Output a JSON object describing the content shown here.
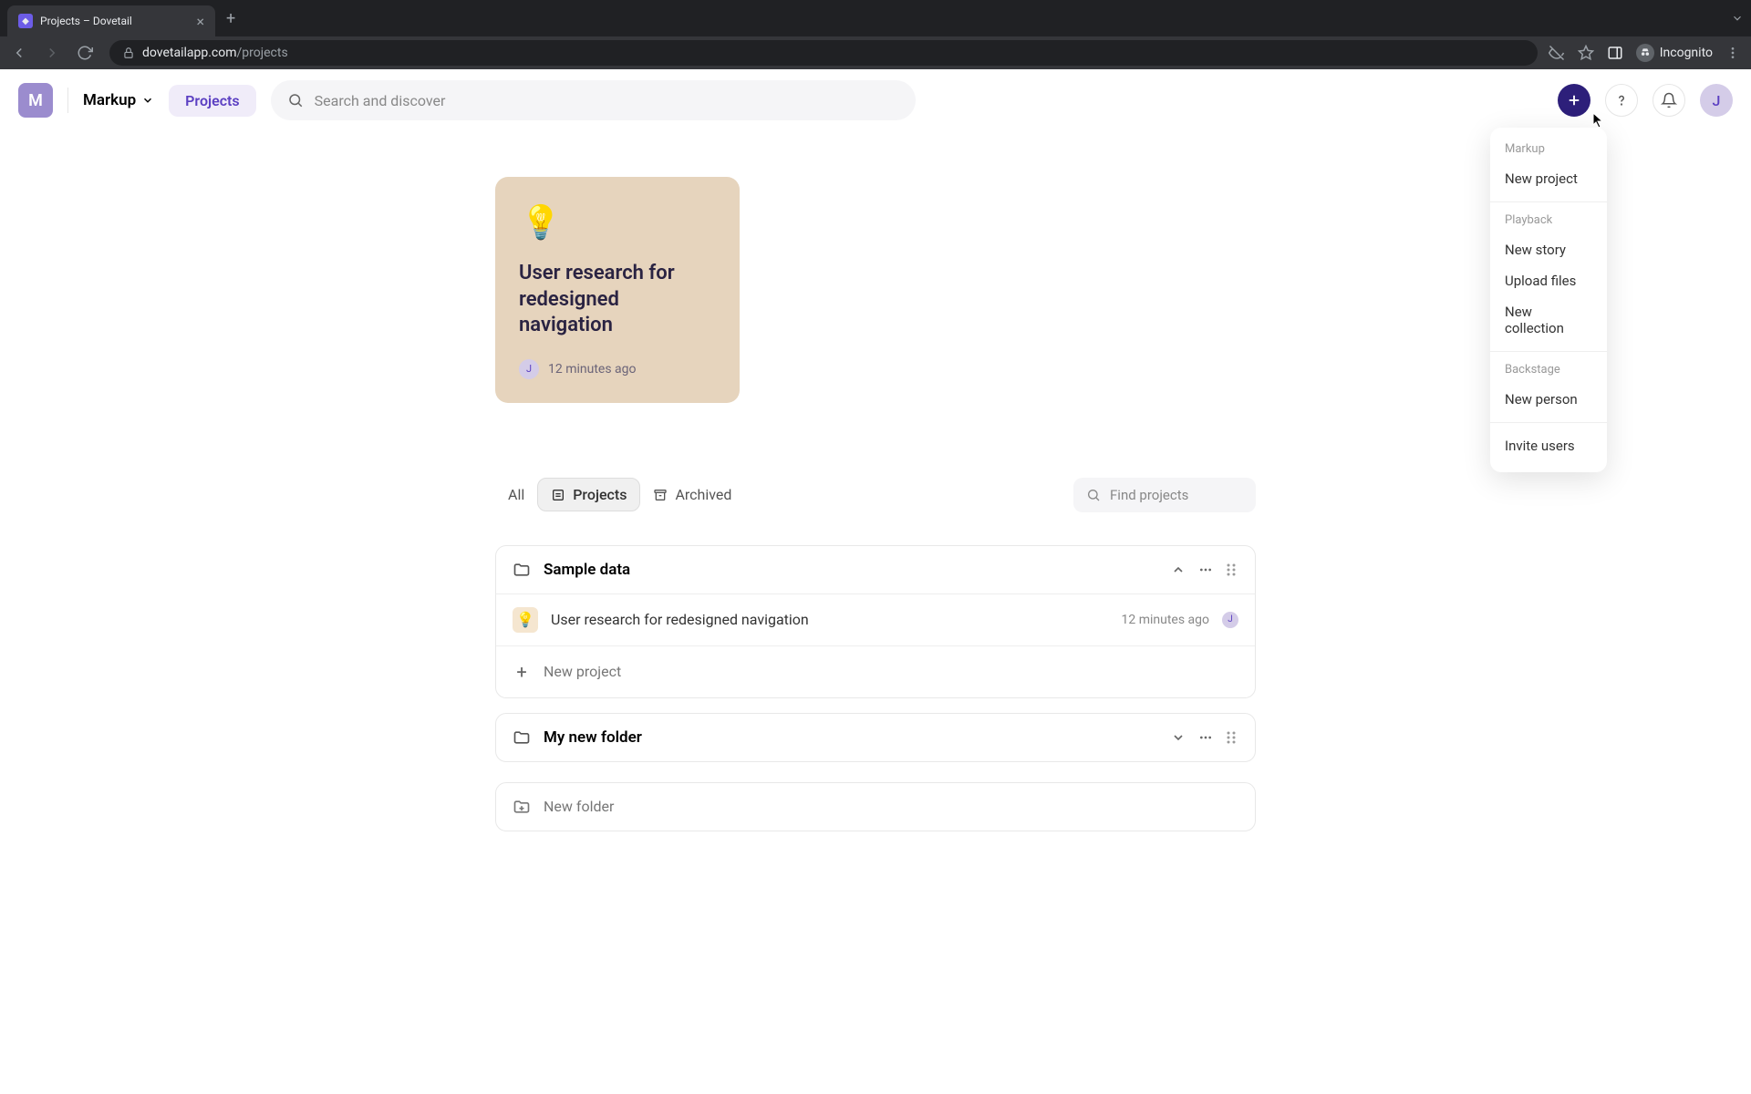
{
  "browser": {
    "tab_title": "Projects – Dovetail",
    "url_domain": "dovetailapp.com",
    "url_path": "/projects",
    "incognito_label": "Incognito"
  },
  "header": {
    "workspace_initial": "M",
    "workspace_name": "Markup",
    "nav_label": "Projects",
    "search_placeholder": "Search and discover",
    "user_initial": "J"
  },
  "dropdown": {
    "sections": [
      {
        "label": "Markup",
        "items": [
          "New project"
        ]
      },
      {
        "label": "Playback",
        "items": [
          "New story",
          "Upload files",
          "New collection"
        ]
      },
      {
        "label": "Backstage",
        "items": [
          "New person"
        ]
      }
    ],
    "footer_item": "Invite users"
  },
  "featured_card": {
    "title": "User research for redesigned navigation",
    "time": "12 minutes ago",
    "author_initial": "J"
  },
  "filters": {
    "all": "All",
    "projects": "Projects",
    "archived": "Archived",
    "find_placeholder": "Find projects"
  },
  "folders": [
    {
      "name": "Sample data",
      "expanded": true,
      "projects": [
        {
          "title": "User research for redesigned navigation",
          "time": "12 minutes ago",
          "author_initial": "J"
        }
      ],
      "new_project_label": "New project"
    },
    {
      "name": "My new folder",
      "expanded": false
    }
  ],
  "new_folder_label": "New folder"
}
